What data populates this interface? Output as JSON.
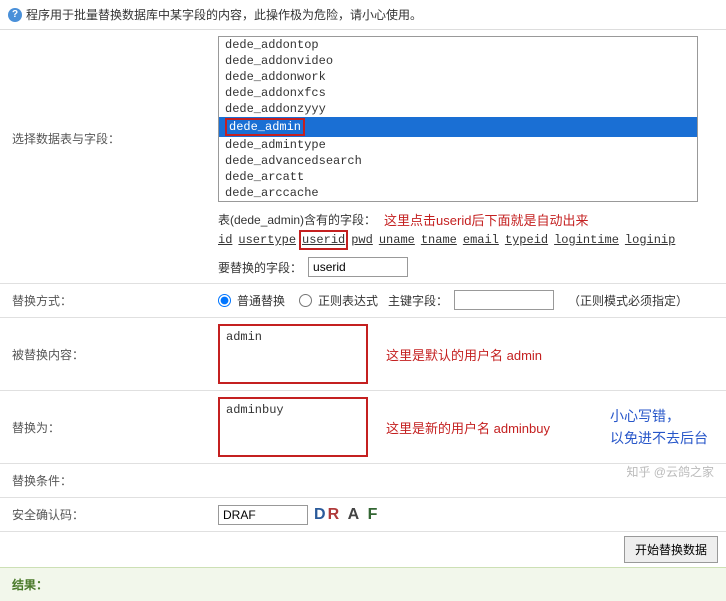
{
  "warning": "程序用于批量替换数据库中某字段的内容，此操作极为危险，请小心使用。",
  "labels": {
    "select_table": "选择数据表与字段：",
    "replace_mode": "替换方式：",
    "replaced_content": "被替换内容：",
    "replace_to": "替换为：",
    "replace_cond": "替换条件：",
    "captcha": "安全确认码：",
    "result": "结果："
  },
  "listbox": {
    "items": [
      "dede_addontop",
      "dede_addonvideo",
      "dede_addonwork",
      "dede_addonxfcs",
      "dede_addonzyyy",
      "dede_admin",
      "dede_admintype",
      "dede_advancedsearch",
      "dede_arcatt",
      "dede_arccache"
    ],
    "selected_index": 5
  },
  "fields_line_prefix": "表(dede_admin)含有的字段：",
  "fields": [
    "id",
    "usertype",
    "userid",
    "pwd",
    "uname",
    "tname",
    "email",
    "typeid",
    "logintime",
    "loginip"
  ],
  "highlight_field_index": 2,
  "replace_field_label": "要替换的字段：",
  "replace_field_value": "userid",
  "mode": {
    "normal": "普通替换",
    "regex": "正则表达式",
    "primary": "主键字段：",
    "hint": "（正则模式必须指定）"
  },
  "content_value": "admin",
  "replace_value": "adminbuy",
  "captcha_value": "DRAF",
  "captcha_chars": [
    "D",
    "R",
    "A",
    "F"
  ],
  "submit": "开始替换数据",
  "annotations": {
    "click_userid": "这里点击userid后下面就是自动出来",
    "default_user": "这里是默认的用户名 admin",
    "new_user": "这里是新的用户名 adminbuy",
    "careful1": "小心写错，",
    "careful2": "以免进不去后台"
  },
  "watermark": "知乎 @云鸽之家"
}
